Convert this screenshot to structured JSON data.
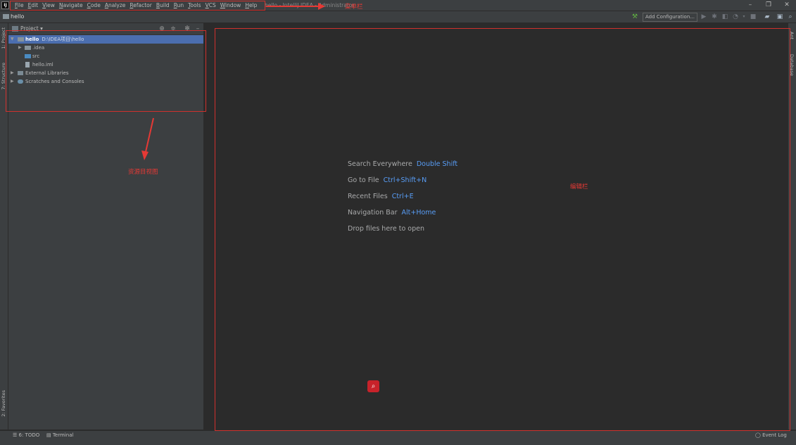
{
  "window": {
    "logo": "IJ",
    "title": "hello - IntelliJ IDEA - Administrator",
    "controls": {
      "minimize": "–",
      "restore": "❐",
      "close": "✕"
    }
  },
  "menu": [
    "File",
    "Edit",
    "View",
    "Navigate",
    "Code",
    "Analyze",
    "Refactor",
    "Build",
    "Run",
    "Tools",
    "VCS",
    "Window",
    "Help"
  ],
  "navbar": {
    "project": "hello",
    "add_configuration": "Add Configuration..."
  },
  "left_tabs": {
    "project": "1: Project",
    "structure": "7: Structure",
    "favorites": "2: Favorites"
  },
  "right_tabs": {
    "ant": "Ant",
    "database": "Database"
  },
  "project_panel": {
    "title": "Project",
    "tree": [
      {
        "label": "hello",
        "path": "D:\\IDEA项目\\hello",
        "depth": 0,
        "expanded": true,
        "selected": true,
        "icon": "module-folder-icon"
      },
      {
        "label": ".idea",
        "depth": 1,
        "expanded": false,
        "icon": "folder-icon"
      },
      {
        "label": "src",
        "depth": 1,
        "icon": "source-folder-icon"
      },
      {
        "label": "hello.iml",
        "depth": 1,
        "icon": "iml-file-icon"
      },
      {
        "label": "External Libraries",
        "depth": 0,
        "expanded": false,
        "icon": "libraries-icon"
      },
      {
        "label": "Scratches and Consoles",
        "depth": 0,
        "expanded": false,
        "icon": "scratches-icon"
      }
    ]
  },
  "editor": {
    "hints": [
      {
        "label": "Search Everywhere",
        "shortcut": "Double Shift"
      },
      {
        "label": "Go to File",
        "shortcut": "Ctrl+Shift+N"
      },
      {
        "label": "Recent Files",
        "shortcut": "Ctrl+E"
      },
      {
        "label": "Navigation Bar",
        "shortcut": "Alt+Home"
      }
    ],
    "drop_hint": "Drop files here to open"
  },
  "statusbar": {
    "todo": "6: TODO",
    "terminal": "Terminal",
    "event_log": "Event Log"
  },
  "annotations": {
    "menu_bar": "菜单栏",
    "project_view": "资源目视图",
    "editor": "编辑栏"
  },
  "colors": {
    "accent": "#4b6eaf",
    "annotation": "#d0312d",
    "shortcut": "#589df6"
  }
}
